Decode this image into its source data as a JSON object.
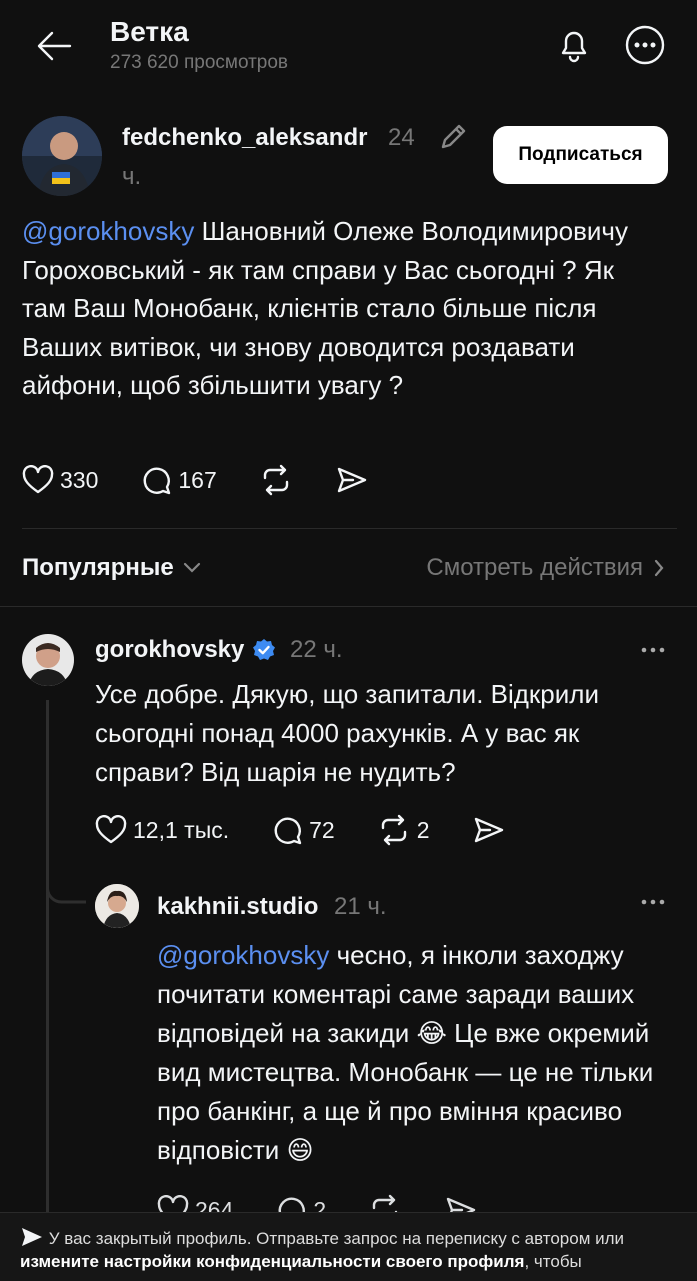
{
  "header": {
    "title": "Ветка",
    "views": "273 620 просмотров"
  },
  "post": {
    "username": "fedchenko_aleksandr",
    "time": "24",
    "time_unit": "ч.",
    "follow_label": "Подписаться",
    "mention": "@gorokhovsky",
    "text": " Шановний Олеже Володимировичу Гороховський - як там справи у Вас сьогодні ? Як там Ваш Монобанк, клієнтів стало більше після Ваших витівок, чи знову доводится роздавати айфони, щоб збільшити увагу ?",
    "likes": "330",
    "comments": "167"
  },
  "sort": {
    "label": "Популярные",
    "activity_label": "Смотреть действия"
  },
  "reply1": {
    "username": "gorokhovsky",
    "time": "22 ч.",
    "text": "Усе добре. Дякую, що запитали. Відкрили сьогодні понад 4000 рахунків. А у вас як справи? Від шарія не нудить?",
    "likes": "12,1 тыс.",
    "comments": "72",
    "reposts": "2"
  },
  "reply2": {
    "username": "kakhnii.studio",
    "time": "21 ч.",
    "mention": "@gorokhovsky",
    "text_a": " чесно, я інколи заходжу почитати коментарі саме заради ваших відповідей на закиди ",
    "emoji_a": "😂",
    "text_b": " Це вже окремий вид мистецтва. Монобанк — це не тільки про банкінг, а ще й про вміння красиво відповісти ",
    "emoji_b": "😄",
    "likes": "264",
    "comments": "2"
  },
  "banner": {
    "text_a": "У вас закрытый профиль. Отправьте запрос на переписку с автором или ",
    "link": "измените настройки конфиденциальности своего профиля",
    "text_b": ", чтобы"
  },
  "colors": {
    "background": "#101010",
    "mention": "#5b8ff0",
    "muted": "#777777",
    "verified": "#3d8bf2"
  }
}
